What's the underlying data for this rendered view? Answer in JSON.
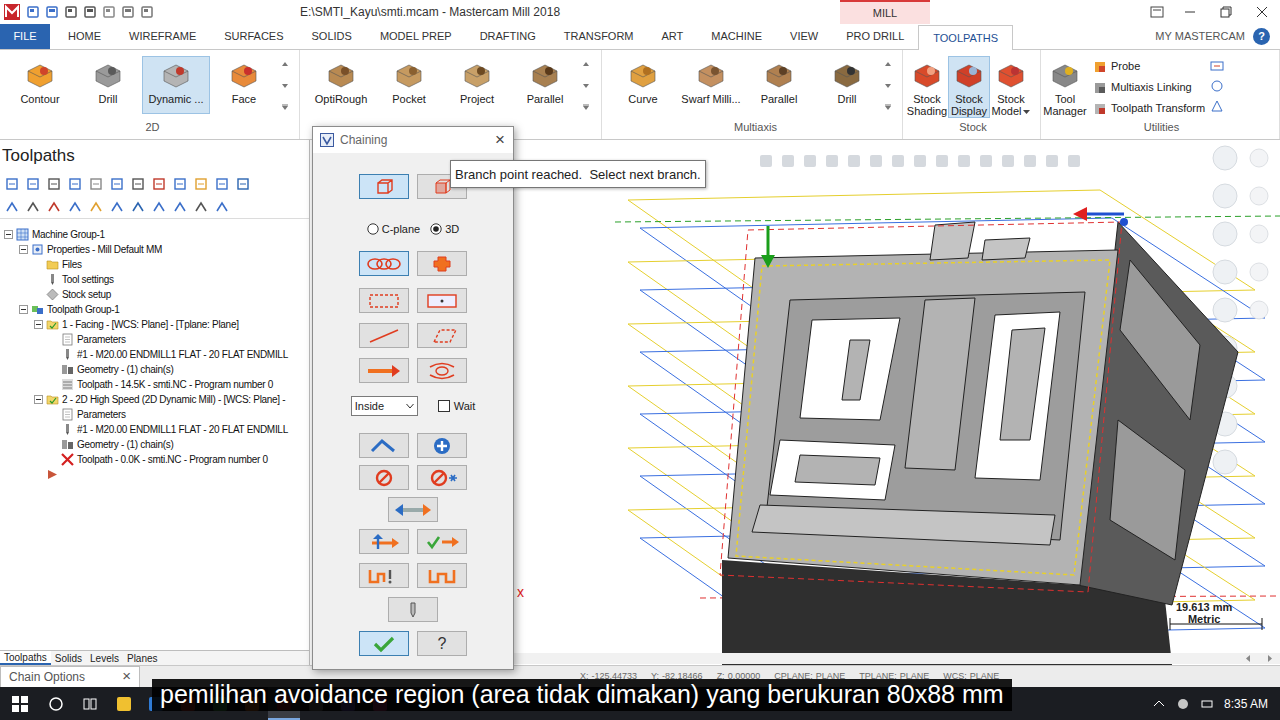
{
  "window": {
    "title": "E:\\SMTI_Kayu\\smti.mcam - Mastercam Mill 2018",
    "context_tab": "MILL"
  },
  "ribbon": {
    "tabs": [
      {
        "label": "FILE",
        "selected": false
      },
      {
        "label": "HOME",
        "selected": false
      },
      {
        "label": "WIREFRAME",
        "selected": false
      },
      {
        "label": "SURFACES",
        "selected": false
      },
      {
        "label": "SOLIDS",
        "selected": false
      },
      {
        "label": "MODEL PREP",
        "selected": false
      },
      {
        "label": "DRAFTING",
        "selected": false
      },
      {
        "label": "TRANSFORM",
        "selected": false
      },
      {
        "label": "ART",
        "selected": false
      },
      {
        "label": "MACHINE",
        "selected": false
      },
      {
        "label": "VIEW",
        "selected": false
      },
      {
        "label": "PRO DRILL",
        "selected": false
      },
      {
        "label": "TOOLPATHS",
        "selected": true
      }
    ],
    "account": "MY MASTERCAM",
    "help": "?",
    "groups": [
      {
        "label": "2D",
        "more": true,
        "buttons": [
          {
            "label": "Contour",
            "selected": false,
            "kind": "large"
          },
          {
            "label": "Drill",
            "selected": false,
            "kind": "large"
          },
          {
            "label": "Dynamic ...",
            "selected": true,
            "kind": "large"
          },
          {
            "label": "Face",
            "selected": false,
            "kind": "large"
          }
        ]
      },
      {
        "more": true,
        "buttons": [
          {
            "label": "OptiRough",
            "selected": false,
            "kind": "large"
          },
          {
            "label": "Pocket",
            "selected": false,
            "kind": "large"
          },
          {
            "label": "Project",
            "selected": false,
            "kind": "large"
          },
          {
            "label": "Parallel",
            "selected": false,
            "kind": "large"
          }
        ]
      },
      {
        "label": "Multiaxis",
        "more": true,
        "buttons": [
          {
            "label": "Curve",
            "selected": false,
            "kind": "large"
          },
          {
            "label": "Swarf Milli...",
            "selected": false,
            "kind": "large"
          },
          {
            "label": "Parallel",
            "selected": false,
            "kind": "large"
          },
          {
            "label": "Drill",
            "selected": false,
            "kind": "large"
          }
        ]
      },
      {
        "label": "Stock",
        "more": false,
        "buttons": [
          {
            "label": "Stock Shading",
            "selected": false,
            "kind": "narrow"
          },
          {
            "label": "Stock Display",
            "selected": true,
            "kind": "narrow"
          },
          {
            "label": "Stock Model",
            "selected": false,
            "kind": "narrow",
            "dropdown": true
          }
        ]
      },
      {
        "label": "Utilities",
        "more": false,
        "buttons": [
          {
            "label": "Tool Manager",
            "selected": false,
            "kind": "narrow"
          },
          {
            "label": "Probe",
            "selected": false,
            "kind": "small"
          },
          {
            "label": "Multiaxis Linking",
            "selected": false,
            "kind": "small"
          },
          {
            "label": "Toolpath Transform",
            "selected": false,
            "kind": "small"
          }
        ]
      }
    ]
  },
  "toolpaths_panel": {
    "title": "Toolpaths",
    "tree": [
      {
        "label": "Machine Group-1",
        "depth": 0,
        "expanded": true,
        "kind": "machine-group"
      },
      {
        "label": "Properties - Mill Default MM",
        "depth": 1,
        "expanded": true,
        "kind": "properties"
      },
      {
        "label": "Files",
        "depth": 2,
        "kind": "folder"
      },
      {
        "label": "Tool settings",
        "depth": 2,
        "kind": "tool"
      },
      {
        "label": "Stock setup",
        "depth": 2,
        "kind": "stock"
      },
      {
        "label": "Toolpath Group-1",
        "depth": 1,
        "expanded": true,
        "kind": "group"
      },
      {
        "label": "1 - Facing - [WCS: Plane] - [Tplane: Plane]",
        "depth": 2,
        "expanded": true,
        "kind": "operation"
      },
      {
        "label": "Parameters",
        "depth": 3,
        "kind": "params"
      },
      {
        "label": "#1 - M20.00 ENDMILL1 FLAT - 20 FLAT ENDMILL",
        "depth": 3,
        "kind": "tool"
      },
      {
        "label": "Geometry - (1) chain(s)",
        "depth": 3,
        "kind": "geometry"
      },
      {
        "label": "Toolpath - 14.5K - smti.NC - Program number 0",
        "depth": 3,
        "kind": "toolpath"
      },
      {
        "label": "2 - 2D High Speed (2D Dynamic Mill) - [WCS: Plane] -",
        "depth": 2,
        "expanded": true,
        "kind": "operation"
      },
      {
        "label": "Parameters",
        "depth": 3,
        "kind": "params"
      },
      {
        "label": "#1 - M20.00 ENDMILL1 FLAT - 20 FLAT ENDMILL",
        "depth": 3,
        "kind": "tool"
      },
      {
        "label": "Geometry - (1) chain(s)",
        "depth": 3,
        "kind": "geometry"
      },
      {
        "label": "Toolpath - 0.0K - smti.NC - Program number 0",
        "depth": 3,
        "kind": "toolpath-dirty"
      },
      {
        "label": "",
        "depth": 2,
        "kind": "insert-arrow"
      }
    ],
    "tabs": [
      {
        "label": "Toolpaths",
        "selected": true
      },
      {
        "label": "Solids",
        "selected": false
      },
      {
        "label": "Levels",
        "selected": false
      },
      {
        "label": "Planes",
        "selected": false
      }
    ]
  },
  "chaining": {
    "title": "Chaining",
    "close": "×",
    "sections": [
      {
        "kind": "buttons",
        "buttons": [
          {
            "kind": "wire-cube",
            "selected": true
          },
          {
            "kind": "solid-cube",
            "selected": false
          }
        ]
      },
      {
        "kind": "radios",
        "options": [
          {
            "label": "C-plane",
            "selected": false
          },
          {
            "label": "3D",
            "selected": true
          }
        ]
      },
      {
        "kind": "buttons",
        "buttons": [
          {
            "kind": "chain",
            "selected": true
          },
          {
            "kind": "point",
            "selected": false
          }
        ]
      },
      {
        "kind": "buttons",
        "buttons": [
          {
            "kind": "window",
            "selected": false
          },
          {
            "kind": "area",
            "selected": false
          }
        ]
      },
      {
        "kind": "buttons",
        "buttons": [
          {
            "kind": "single",
            "selected": false
          },
          {
            "kind": "polygon",
            "selected": false
          }
        ]
      },
      {
        "kind": "buttons",
        "buttons": [
          {
            "kind": "vector",
            "selected": false
          },
          {
            "kind": "partial",
            "selected": false
          }
        ]
      },
      {
        "kind": "options",
        "dropdown": {
          "value": "Inside"
        },
        "checkbox": {
          "label": "Wait",
          "checked": false
        }
      },
      {
        "kind": "buttons",
        "buttons": [
          {
            "kind": "last",
            "selected": false
          },
          {
            "kind": "add",
            "selected": false
          }
        ]
      },
      {
        "kind": "buttons",
        "buttons": [
          {
            "kind": "unselect",
            "selected": false
          },
          {
            "kind": "unselect-all",
            "selected": false
          }
        ]
      },
      {
        "kind": "buttons",
        "buttons": [
          {
            "kind": "reverse",
            "selected": false
          }
        ]
      },
      {
        "kind": "buttons",
        "buttons": [
          {
            "kind": "modify",
            "selected": false
          },
          {
            "kind": "next",
            "selected": false
          }
        ]
      },
      {
        "kind": "buttons",
        "buttons": [
          {
            "kind": "end",
            "selected": false
          },
          {
            "kind": "start",
            "selected": false
          }
        ]
      },
      {
        "kind": "buttons",
        "buttons": [
          {
            "kind": "dynamic",
            "selected": false
          }
        ]
      },
      {
        "kind": "actions",
        "ok": {
          "selected": true
        },
        "help": {
          "label": "?"
        }
      }
    ]
  },
  "tooltip": "Branch point reached.  Select next branch.",
  "graphics": {
    "axis_label": "x",
    "scale": {
      "value": "19.613 mm",
      "unit": "Metric"
    }
  },
  "chain_options_tab": {
    "label": "Chain Options",
    "close": "×"
  },
  "status_bar": [
    {
      "label": "X:",
      "value": "-125.44733"
    },
    {
      "label": "Y:",
      "value": "-82.18466"
    },
    {
      "label": "Z:",
      "value": "0.00000"
    },
    {
      "label": "CPLANE:",
      "value": "PLANE"
    },
    {
      "label": "TPLANE:",
      "value": "PLANE"
    },
    {
      "label": "WCS:",
      "value": "PLANE"
    }
  ],
  "subtitle": "pemilihan avoidance region (area tidak dimakan) yang berukuran 80x88 mm",
  "taskbar": {
    "clock": "8:35 AM"
  }
}
